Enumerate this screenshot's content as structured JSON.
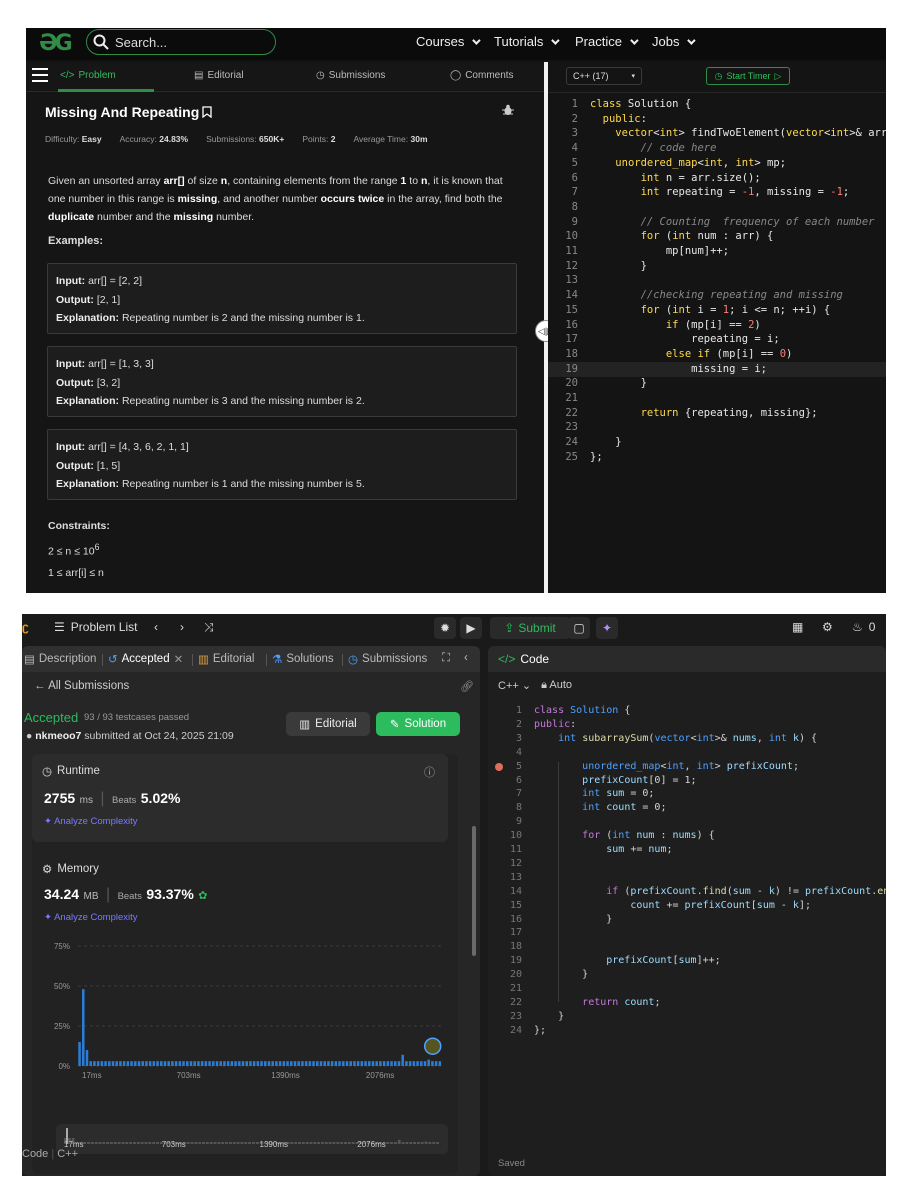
{
  "gfg": {
    "search_placeholder": "Search...",
    "nav": [
      "Courses",
      "Tutorials",
      "Practice",
      "Jobs"
    ],
    "tabs": [
      "Problem",
      "Editorial",
      "Submissions",
      "Comments"
    ],
    "title": "Missing And Repeating",
    "meta": {
      "difficulty_label": "Difficulty:",
      "difficulty": "Easy",
      "accuracy_label": "Accuracy:",
      "accuracy": "24.83%",
      "submissions_label": "Submissions:",
      "submissions": "650K+",
      "points_label": "Points:",
      "points": "2",
      "avg_label": "Average Time:",
      "avg_time": "30m"
    },
    "description": {
      "p1": "Given an unsorted array ",
      "arr": "arr[]",
      "p2": " of size ",
      "n": "n",
      "p3": ", containing elements from the range ",
      "one": "1",
      "p4": " to ",
      "n2": "n",
      "p5": ", it is known that one number in this range is ",
      "missing": "missing",
      "p6": ", and another number ",
      "twice": "occurs twice",
      "p7": " in the array, find both the ",
      "duplicate": "duplicate",
      "p8": " number and the ",
      "missing2": "missing",
      "p9": " number."
    },
    "examples_label": "Examples:",
    "examples": [
      {
        "input_label": "Input:",
        "input": "arr[] = [2, 2]",
        "output_label": "Output:",
        "output": "[2, 1]",
        "expl_label": "Explanation:",
        "explanation": "Repeating number is 2 and the missing number is 1."
      },
      {
        "input_label": "Input:",
        "input": "arr[] = [1, 3, 3]",
        "output_label": "Output:",
        "output": "[3, 2]",
        "expl_label": "Explanation:",
        "explanation": "Repeating number is 3 and the missing number is 2."
      },
      {
        "input_label": "Input:",
        "input": "arr[] = [4, 3, 6, 2, 1, 1]",
        "output_label": "Output:",
        "output": "[1, 5]",
        "expl_label": "Explanation:",
        "explanation": "Repeating number is 1 and the missing number is 5."
      }
    ],
    "constraints_label": "Constraints:",
    "constraint1": "2 ≤ n ≤ 10",
    "constraint1_sup": "6",
    "constraint2": "1 ≤ arr[i] ≤ n",
    "lang": "C++ (17)",
    "timer_label": "Start Timer",
    "code_lines": [
      "class Solution {",
      "  public:",
      "    vector<int> findTwoElement(vector<int>& arr",
      "        // code here",
      "    unordered_map<int, int> mp;",
      "        int n = arr.size();",
      "        int repeating = -1, missing = -1;",
      "",
      "        // Counting  frequency of each number",
      "        for (int num : arr) {",
      "            mp[num]++;",
      "        }",
      "",
      "        //checking repeating and missing",
      "        for (int i = 1; i <= n; ++i) {",
      "            if (mp[i] == 2)",
      "                repeating = i;",
      "            else if (mp[i] == 0)",
      "                missing = i;",
      "        }",
      "",
      "        return {repeating, missing};",
      "",
      "    }",
      "};"
    ]
  },
  "lc": {
    "problem_list": "Problem List",
    "submit": "Submit",
    "streak": "0",
    "tabs": [
      "Description",
      "Accepted",
      "Editorial",
      "Solutions",
      "Submissions"
    ],
    "all_submissions": "All Submissions",
    "status": "Accepted",
    "passed": "93 / 93 testcases passed",
    "user": "nkmeoo7",
    "submitted_text": " submitted at Oct 24, 2025 21:09",
    "editorial_btn": "Editorial",
    "solution_btn": "Solution",
    "runtime_label": "Runtime",
    "runtime_value": "2755",
    "runtime_unit": "ms",
    "beats_label": "Beats",
    "runtime_beats": "5.02%",
    "analyze": "Analyze Complexity",
    "memory_label": "Memory",
    "memory_value": "34.24",
    "memory_unit": "MB",
    "memory_beats": "93.37%",
    "code_label": "Code",
    "code_lang": "C++",
    "editor_title": "Code",
    "editor_lang": "C++",
    "editor_mode": "Auto",
    "saved": "Saved",
    "code_lines": [
      "class Solution {",
      "public:",
      "    int subarraySum(vector<int>& nums, int k) {",
      "",
      "        unordered_map<int, int> prefixCount;",
      "        prefixCount[0] = 1;",
      "        int sum = 0;",
      "        int count = 0;",
      "",
      "        for (int num : nums) {",
      "            sum += num;",
      "",
      "",
      "            if (prefixCount.find(sum - k) != prefixCount.end",
      "                count += prefixCount[sum - k];",
      "            }",
      "",
      "",
      "            prefixCount[sum]++;",
      "        }",
      "",
      "        return count;",
      "    }",
      "};"
    ]
  },
  "chart_data": {
    "type": "bar",
    "yticks": [
      "75%",
      "50%",
      "25%",
      "0%"
    ],
    "xticks": [
      "17ms",
      "703ms",
      "1390ms",
      "2076ms"
    ],
    "ylim": [
      0,
      75
    ],
    "values": [
      15,
      48,
      10,
      3,
      3,
      3,
      3,
      3,
      3,
      3,
      3,
      3,
      3,
      3,
      3,
      3,
      3,
      3,
      3,
      3,
      3,
      3,
      3,
      3,
      3,
      3,
      3,
      3,
      3,
      3,
      3,
      3,
      3,
      3,
      3,
      3,
      3,
      3,
      3,
      3,
      3,
      3,
      3,
      3,
      3,
      3,
      3,
      3,
      3,
      3,
      3,
      3,
      3,
      3,
      3,
      3,
      3,
      3,
      3,
      3,
      3,
      3,
      3,
      3,
      3,
      3,
      3,
      3,
      3,
      3,
      3,
      3,
      3,
      3,
      3,
      3,
      3,
      3,
      3,
      3,
      3,
      3,
      3,
      3,
      3,
      3,
      3,
      7,
      3,
      3,
      3,
      3,
      3,
      3,
      4,
      3,
      3,
      3
    ],
    "highlight_index": 95,
    "colors": {
      "bar": "#2b7ed8",
      "grid": "#3a3a3a"
    }
  }
}
